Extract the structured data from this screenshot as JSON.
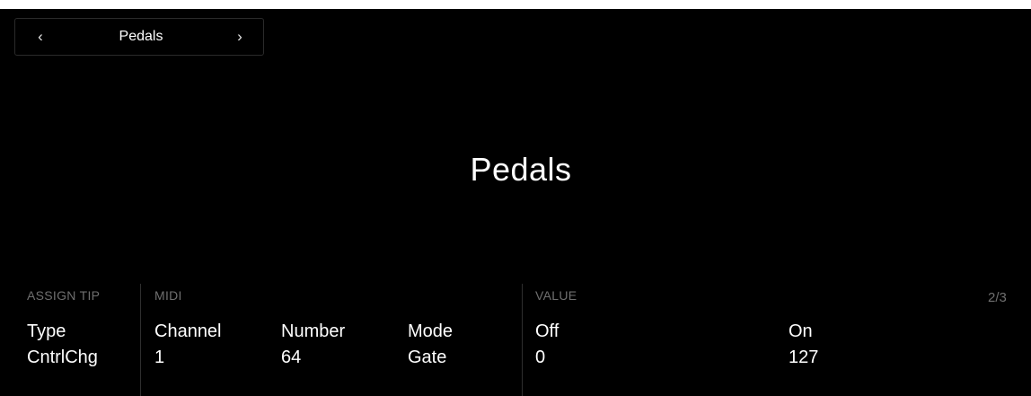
{
  "nav": {
    "prev_icon": "chevron-left-icon",
    "prev_glyph": "‹",
    "title": "Pedals",
    "next_icon": "chevron-right-icon",
    "next_glyph": "›"
  },
  "main": {
    "title": "Pedals"
  },
  "sections": {
    "assign_tip": "ASSIGN TIP",
    "midi": "MIDI",
    "value": "VALUE"
  },
  "page_indicator": "2/3",
  "params": {
    "type": {
      "label": "Type",
      "value": "CntrlChg"
    },
    "channel": {
      "label": "Channel",
      "value": "1"
    },
    "number": {
      "label": "Number",
      "value": "64"
    },
    "mode": {
      "label": "Mode",
      "value": "Gate"
    },
    "off": {
      "label": "Off",
      "value": "0"
    },
    "on": {
      "label": "On",
      "value": "127"
    }
  }
}
